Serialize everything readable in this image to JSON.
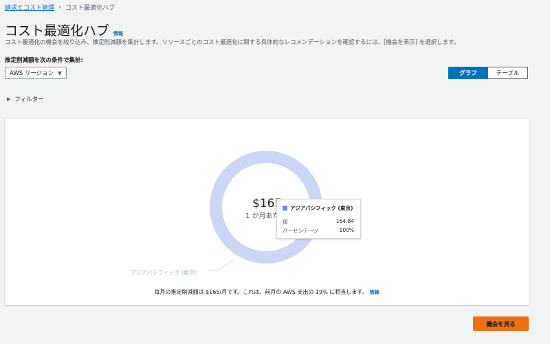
{
  "breadcrumb": {
    "parent": "請求とコスト管理",
    "current": "コスト最適化ハブ"
  },
  "header": {
    "title": "コスト最適化ハブ",
    "info": "情報",
    "description": "コスト最適化の機会を絞り込み、推定削減額を集計します。リソースごとのコスト最適化に関する具体的なレコメンデーションを確認するには、[機会を表示] を選択します。"
  },
  "grouping": {
    "label": "推定削減額を次の条件で集計:",
    "selected": "AWS リージョン"
  },
  "view_toggle": {
    "graph": "グラフ",
    "table": "テーブル",
    "active": "グラフ"
  },
  "filter": {
    "label": "フィルター"
  },
  "chart_data": {
    "type": "pie",
    "categories": [
      "アジアパシフィック (東京)"
    ],
    "values": [
      164.84
    ],
    "center_value": "$165",
    "center_sub": "1 か月あたり",
    "colors": [
      "#ccd7f5"
    ]
  },
  "tooltip": {
    "title": "アジアパシフィック (東京)",
    "value_label": "値",
    "value": "164.84",
    "percent_label": "パーセンテージ",
    "percent": "100%",
    "swatch_color": "#6a8be8"
  },
  "footnote": {
    "text": "毎月の推定削減額は $165/月です。これは、前月の AWS 支出の 19% に相当します。",
    "info": "情報"
  },
  "actions": {
    "view_opportunities": "機会を見る"
  }
}
